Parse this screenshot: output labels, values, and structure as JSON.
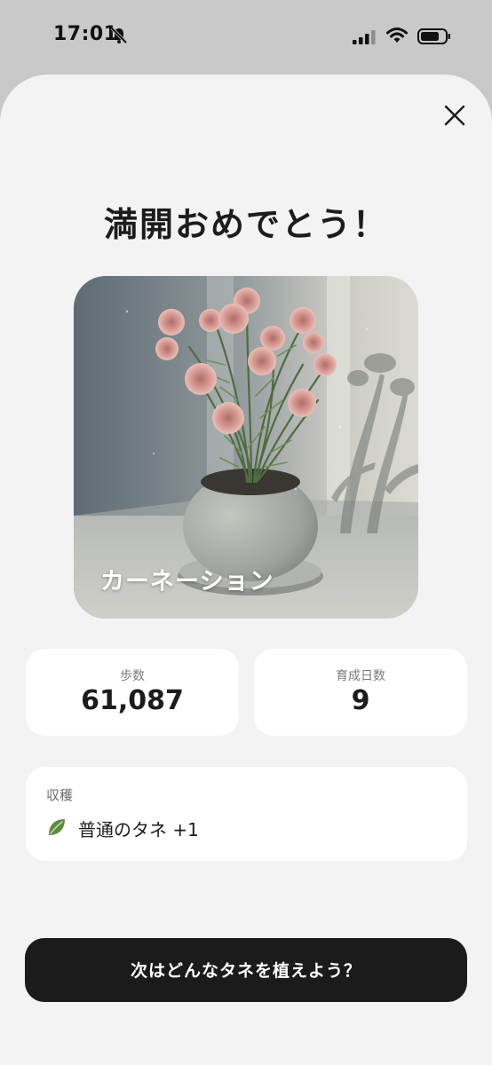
{
  "status_bar": {
    "time": "17:01",
    "icons": [
      "bell-off-icon",
      "signal-icon",
      "wifi-icon",
      "battery-icon"
    ]
  },
  "modal": {
    "title": "満開おめでとう！",
    "close_icon": "close-icon",
    "plant": {
      "name": "カーネーション",
      "image": "potted-carnation-image"
    },
    "stats": [
      {
        "label": "歩数",
        "value": "61,087"
      },
      {
        "label": "育成日数",
        "value": "9"
      }
    ],
    "harvest": {
      "title": "収穫",
      "icon": "leaf-icon",
      "item": "普通のタネ +1"
    },
    "cta_label": "次はどんなタネを植えよう？"
  },
  "colors": {
    "background": "#f3f3f3",
    "card": "#ffffff",
    "button": "#1b1b1b",
    "leaf": "#5e8a3e"
  }
}
